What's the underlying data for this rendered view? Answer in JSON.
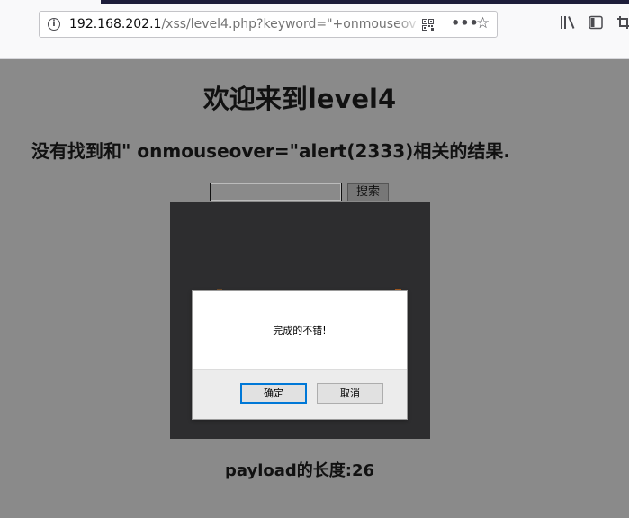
{
  "browser": {
    "url_host": "192.168.202.1",
    "url_rest": "/xss/level4.php?keyword=\"+onmouseov",
    "icons": {
      "info": "info-icon",
      "qr": "qr-code-icon",
      "more": "more-icon",
      "bookmark": "star-icon",
      "library": "library-icon",
      "sidebar": "sidebar-icon",
      "screenshot": "screenshot-icon"
    },
    "more_glyph": "•••",
    "star_glyph": "☆",
    "info_glyph": "i"
  },
  "page": {
    "title": "欢迎来到level4",
    "result_text": "没有找到和\" onmouseover=\"alert(2333)相关的结果.",
    "search": {
      "value": "",
      "button_label": "搜索"
    },
    "payload_length": "payload的长度:26"
  },
  "alert": {
    "message": "完成的不错!",
    "ok_label": "确定",
    "cancel_label": "取消",
    "accent_color": "#0078d7"
  },
  "colors": {
    "page_background": "#8a8a8a",
    "image_background": "#2d2d2f"
  }
}
